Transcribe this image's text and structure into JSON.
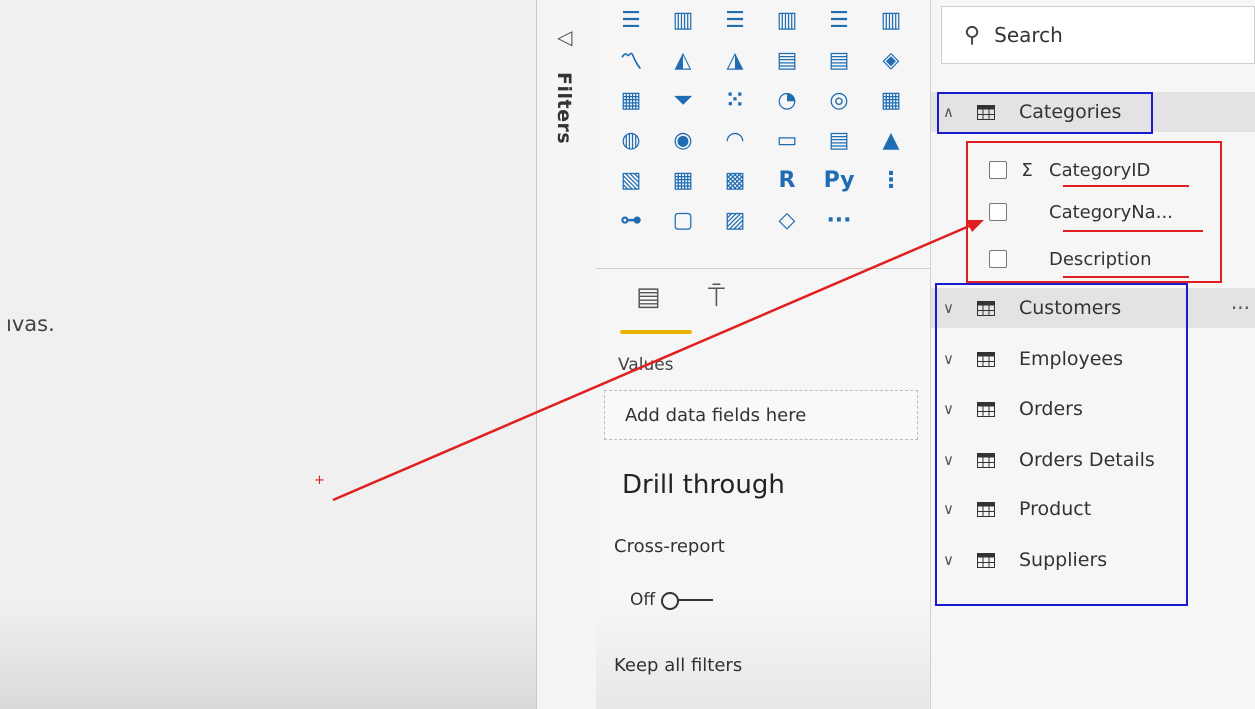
{
  "canvas": {
    "partial_text": "ıvas."
  },
  "filters": {
    "label": "Filters"
  },
  "visualizations": {
    "icons": [
      {
        "name": "stacked-bar-chart-icon",
        "glyph": "☰"
      },
      {
        "name": "stacked-column-chart-icon",
        "glyph": "▥"
      },
      {
        "name": "clustered-bar-chart-icon",
        "glyph": "☰"
      },
      {
        "name": "clustered-column-chart-icon",
        "glyph": "▥"
      },
      {
        "name": "100-stacked-bar-chart-icon",
        "glyph": "☰"
      },
      {
        "name": "100-stacked-column-chart-icon",
        "glyph": "▥"
      },
      {
        "name": "line-chart-icon",
        "glyph": "〽"
      },
      {
        "name": "area-chart-icon",
        "glyph": "◭"
      },
      {
        "name": "stacked-area-chart-icon",
        "glyph": "◮"
      },
      {
        "name": "line-and-stacked-column-icon",
        "glyph": "▤"
      },
      {
        "name": "line-and-clustered-column-icon",
        "glyph": "▤"
      },
      {
        "name": "ribbon-chart-icon",
        "glyph": "◈"
      },
      {
        "name": "waterfall-chart-icon",
        "glyph": "▦"
      },
      {
        "name": "funnel-icon",
        "glyph": "⏷"
      },
      {
        "name": "scatter-chart-icon",
        "glyph": "⁙"
      },
      {
        "name": "pie-chart-icon",
        "glyph": "◔"
      },
      {
        "name": "donut-chart-icon",
        "glyph": "◎"
      },
      {
        "name": "treemap-icon",
        "glyph": "▦"
      },
      {
        "name": "map-icon",
        "glyph": "◍"
      },
      {
        "name": "filled-map-icon",
        "glyph": "◉"
      },
      {
        "name": "gauge-icon",
        "glyph": "◠"
      },
      {
        "name": "card-icon",
        "glyph": "▭"
      },
      {
        "name": "multi-row-card-icon",
        "glyph": "▤"
      },
      {
        "name": "kpi-icon",
        "glyph": "▲"
      },
      {
        "name": "slicer-icon",
        "glyph": "▧"
      },
      {
        "name": "table-icon",
        "glyph": "▦"
      },
      {
        "name": "matrix-icon",
        "glyph": "▩"
      },
      {
        "name": "r-visual-icon",
        "glyph": "R"
      },
      {
        "name": "python-visual-icon",
        "glyph": "Py"
      },
      {
        "name": "key-influencers-icon",
        "glyph": "⋮"
      },
      {
        "name": "decomposition-tree-icon",
        "glyph": "⊶"
      },
      {
        "name": "qa-icon",
        "glyph": "▢"
      },
      {
        "name": "smart-narrative-icon",
        "glyph": "▨"
      },
      {
        "name": "power-apps-icon",
        "glyph": "◇"
      },
      {
        "name": "more-visuals-icon",
        "glyph": "···"
      }
    ],
    "values_label": "Values",
    "dropzone_text": "Add data fields here",
    "drill_through_title": "Drill through",
    "cross_report_label": "Cross-report",
    "cross_report_state": "Off",
    "keep_all_filters_label": "Keep all filters"
  },
  "fields": {
    "search_placeholder": "Search",
    "tables": [
      {
        "name": "Categories",
        "expanded": true,
        "fields": [
          {
            "name": "CategoryID",
            "sigma": true
          },
          {
            "name": "CategoryNa...",
            "sigma": false
          },
          {
            "name": "Description",
            "sigma": false
          }
        ]
      },
      {
        "name": "Customers"
      },
      {
        "name": "Employees"
      },
      {
        "name": "Orders"
      },
      {
        "name": "Orders Details"
      },
      {
        "name": "Product"
      },
      {
        "name": "Suppliers"
      }
    ],
    "more_options": "···"
  },
  "annotation_colors": {
    "blue": "#1a1acf",
    "red": "#e02020"
  },
  "accent": "#e8b300"
}
